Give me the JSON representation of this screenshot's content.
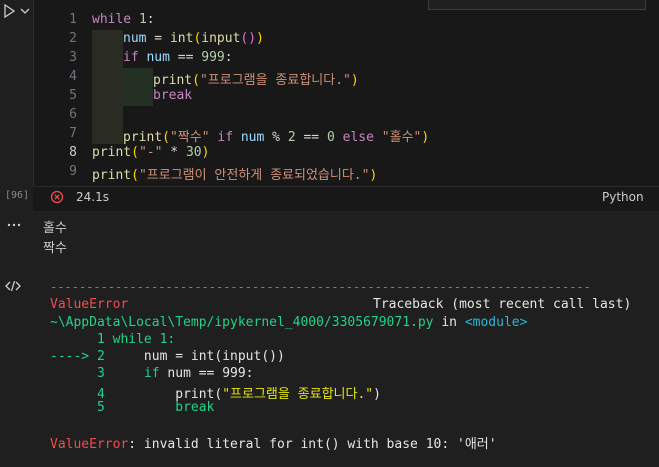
{
  "cell": {
    "exec_count": "[96]",
    "duration": "24.1s",
    "language": "Python",
    "line_numbers": [
      "1",
      "2",
      "3",
      "4",
      "5",
      "6",
      "7",
      "8",
      "9"
    ],
    "code": {
      "l1_kw": "while",
      "l1_num": "1",
      "l1_colon": ":",
      "l2_var": "num",
      "l2_eq": " = ",
      "l2_fn1": "int",
      "l2_p1": "(",
      "l2_fn2": "input",
      "l2_p2": "()",
      "l2_p3": ")",
      "l3_kw": "if",
      "l3_var": "num",
      "l3_op": " == ",
      "l3_num": "999",
      "l3_colon": ":",
      "l4_fn": "print",
      "l4_p1": "(",
      "l4_str": "\"프로그램을 종료합니다.\"",
      "l4_p2": ")",
      "l5_kw": "break",
      "l7_fn": "print",
      "l7_p1": "(",
      "l7_str1": "\"짝수\"",
      "l7_if": "if",
      "l7_var": "num",
      "l7_op": " % ",
      "l7_num1": "2",
      "l7_eq": " == ",
      "l7_num2": "0",
      "l7_else": "else",
      "l7_str2": "\"홀수\"",
      "l7_p2": ")",
      "l8_fn": "print",
      "l8_p1": "(",
      "l8_str": "\"-\"",
      "l8_op": " * ",
      "l8_num": "30",
      "l8_p2": ")",
      "l9_fn": "print",
      "l9_p1": "(",
      "l9_str": "\"프로그램이 안전하게 종료되었습니다.\"",
      "l9_p2": ")"
    }
  },
  "output": {
    "stdout_lines": [
      "홀수",
      "짝수"
    ],
    "traceback": {
      "dashes": "---------------------------------------------------------------------------",
      "error_name": "ValueError",
      "traceback_header": "Traceback (most recent call last)",
      "file_path": "~\\AppData\\Local\\Temp/ipykernel_4000/3305679071.py",
      "in_word": " in ",
      "module": "<module>",
      "lines": [
        {
          "marker": "      ",
          "num": "1",
          "code_kw": "while",
          "code_rest": " 1:"
        },
        {
          "marker": "----> ",
          "num": "2",
          "code_rest": "     num = int(input())"
        },
        {
          "marker": "      ",
          "num": "3",
          "code_kw": "if",
          "code_rest": " num == 999:"
        },
        {
          "marker": "      ",
          "num": "4",
          "code_fn": "print",
          "code_str": "\"프로그램을 종료합니다.\"",
          "code_rest": ")"
        },
        {
          "marker": "      ",
          "num": "5",
          "code_kw": "break"
        }
      ],
      "final_error_name": "ValueError",
      "final_message": ": invalid literal for int() with base 10: '애러'"
    }
  },
  "colors": {
    "accent": "#f14c4c",
    "keyword": "#c586c0",
    "function": "#dcdcaa",
    "string": "#ce9178"
  }
}
